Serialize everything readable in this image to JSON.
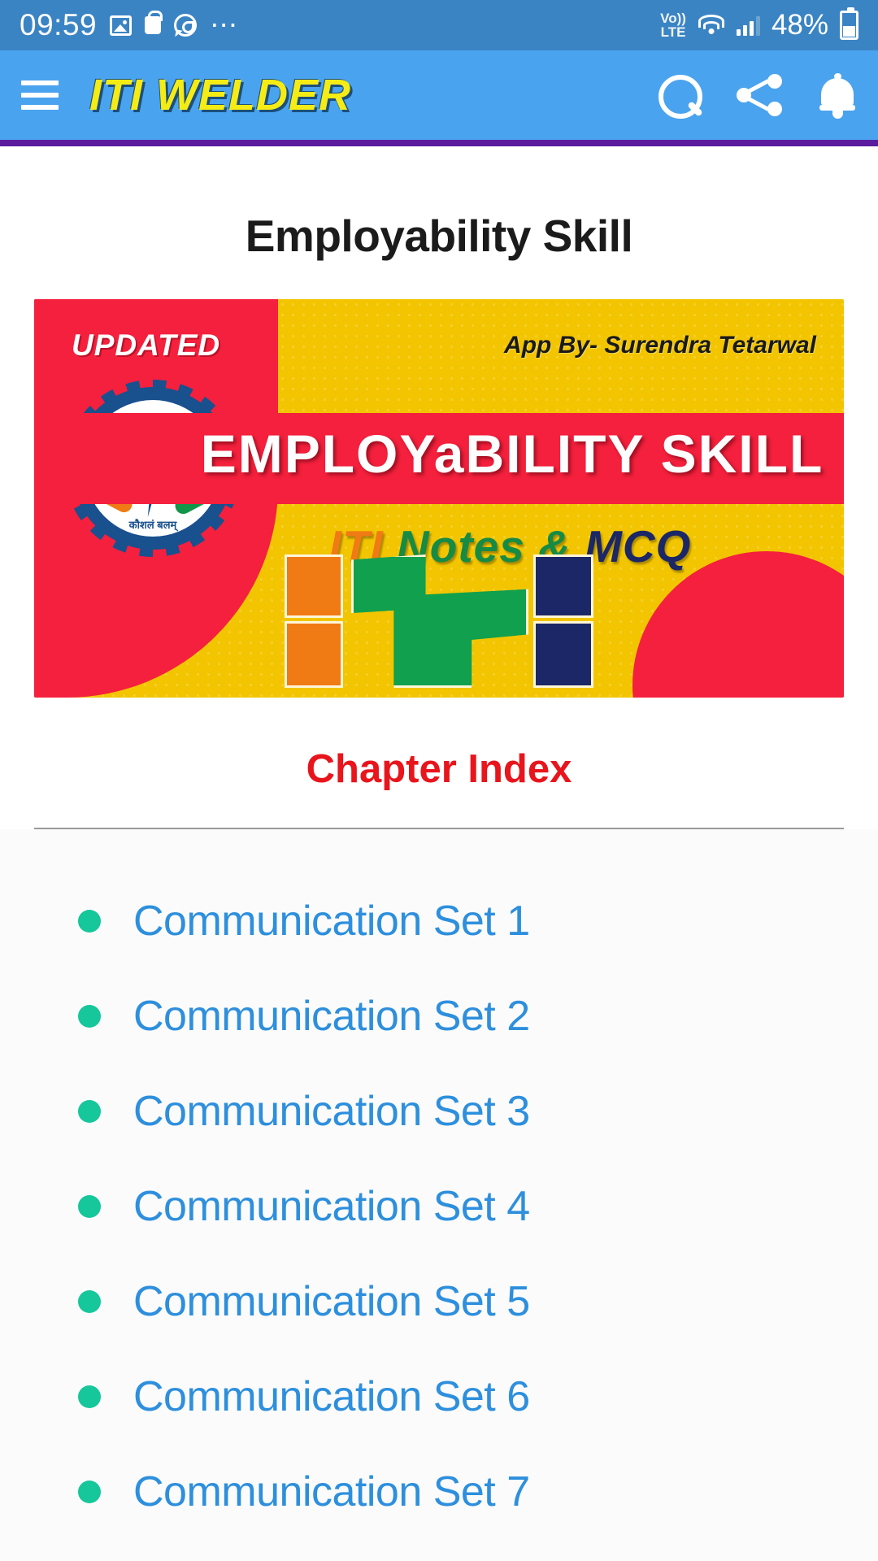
{
  "status_bar": {
    "time": "09:59",
    "icons_left": [
      "gallery-icon",
      "shopping-bag-icon",
      "whatsapp-icon",
      "more-dots-icon"
    ],
    "network_label_top": "Vo))",
    "network_label_bottom": "LTE",
    "icons_right": [
      "volte-icon",
      "wifi-icon",
      "signal-icon",
      "battery-icon"
    ],
    "battery_percent": "48%"
  },
  "app_bar": {
    "menu_icon": "hamburger-menu-icon",
    "title": "ITI WELDER",
    "actions": [
      {
        "name": "search-icon"
      },
      {
        "name": "share-icon"
      },
      {
        "name": "bell-icon"
      }
    ],
    "colors": {
      "background": "#4aa3ee",
      "title": "#f5ec15",
      "rule": "#5b1b9e"
    }
  },
  "main": {
    "page_title": "Employability Skill",
    "banner": {
      "badge": "UPDATED",
      "credit": "App By- Surendra Tetarwal",
      "title": "EMPLOYaBILITY SKILL",
      "subtitle_parts": {
        "iti": "ITI",
        "notes": "Notes &",
        "mcq": "MCQ"
      },
      "logo_motto": "कौशलं बलम्",
      "colors": {
        "red": "#f4203d",
        "yellow": "#f2c500",
        "orange": "#f07a14",
        "green": "#11a04d",
        "navy": "#1b2766"
      }
    },
    "chapter_index_heading": "Chapter Index",
    "chapter_index_color": "#e8151c",
    "bullet_color": "#15c79a",
    "link_color": "#2d8fdd",
    "chapters": [
      "Communication Set 1",
      "Communication Set 2",
      "Communication Set 3",
      "Communication Set 4",
      "Communication Set 5",
      "Communication Set 6",
      "Communication Set 7"
    ]
  }
}
